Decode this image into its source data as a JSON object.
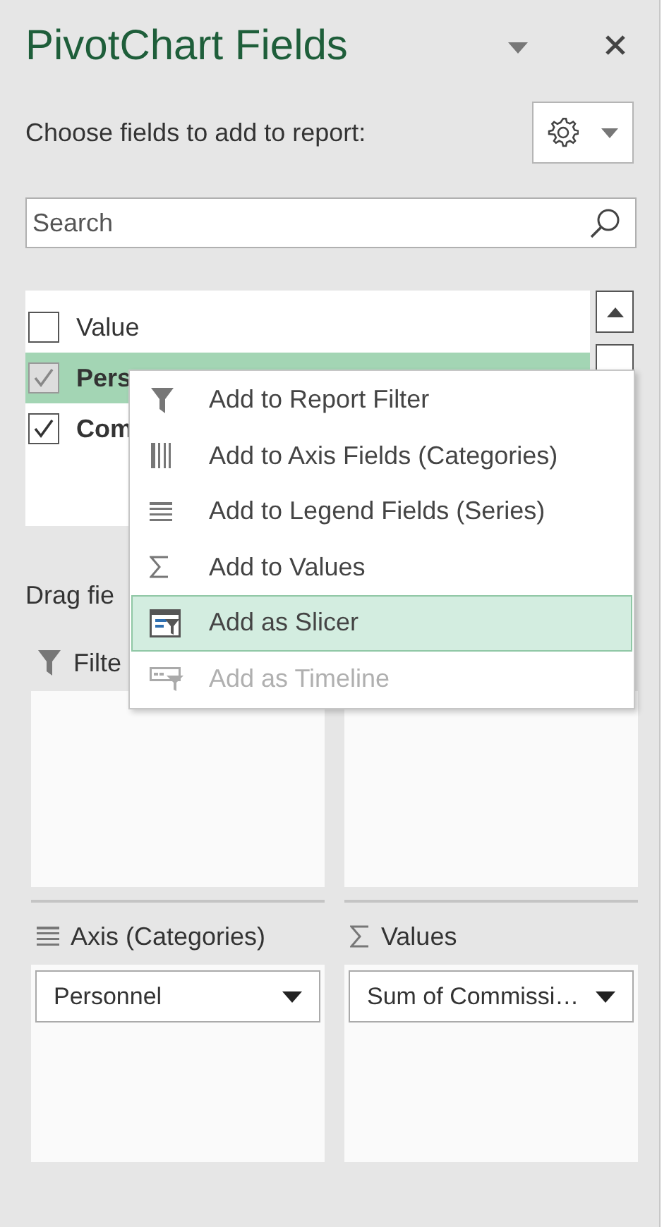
{
  "panel": {
    "title": "PivotChart Fields",
    "choose_label": "Choose fields to add to report:",
    "search": {
      "placeholder": "Search"
    },
    "fields": [
      {
        "label": "Value",
        "checked": false,
        "selected": false
      },
      {
        "label": "Pers",
        "checked": true,
        "selected": true
      },
      {
        "label": "Com",
        "checked": true,
        "selected": false
      }
    ],
    "drag_label": "Drag fie",
    "areas": [
      {
        "kind": "filters",
        "title": "Filte"
      },
      {
        "kind": "legend"
      },
      {
        "kind": "axis",
        "title": "Axis (Categories)",
        "items": [
          "Personnel"
        ]
      },
      {
        "kind": "values",
        "title": "Values",
        "items": [
          "Sum of Commissi…"
        ]
      }
    ]
  },
  "context_menu": {
    "items": [
      {
        "kind": "filter",
        "label": "Add to Report Filter",
        "selected": false,
        "disabled": false
      },
      {
        "kind": "axis",
        "label": "Add to Axis Fields (Categories)",
        "selected": false,
        "disabled": false
      },
      {
        "kind": "legend",
        "label": "Add to Legend Fields (Series)",
        "selected": false,
        "disabled": false
      },
      {
        "kind": "values",
        "label": "Add to Values",
        "selected": false,
        "disabled": false
      },
      {
        "kind": "slicer",
        "label": "Add as Slicer",
        "selected": true,
        "disabled": false
      },
      {
        "kind": "timeline",
        "label": "Add as Timeline",
        "selected": false,
        "disabled": true
      }
    ]
  }
}
